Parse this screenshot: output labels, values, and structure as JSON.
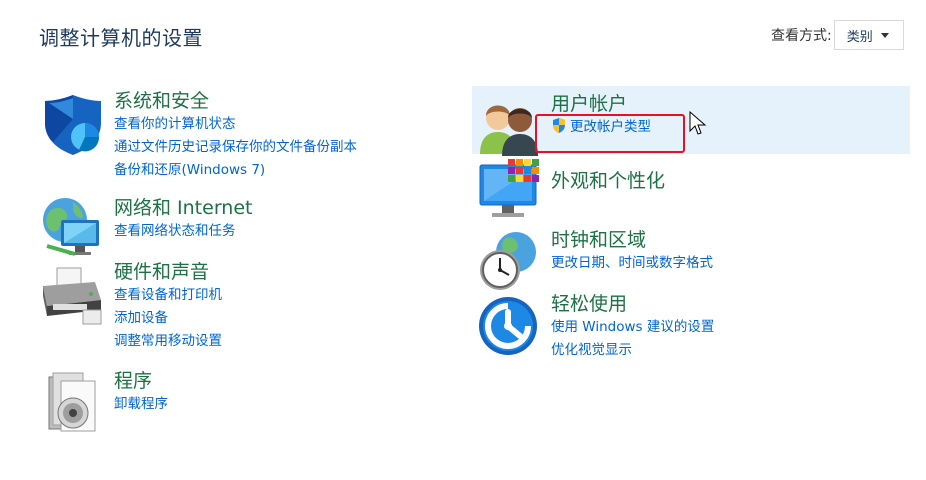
{
  "header": {
    "title": "调整计算机的设置",
    "view_by_label": "查看方式:",
    "view_by_value": "类别"
  },
  "categories_left": [
    {
      "id": "system-security",
      "icon": "shield-icon",
      "title": "系统和安全",
      "links": [
        "查看你的计算机状态",
        "通过文件历史记录保存你的文件备份副本",
        "备份和还原(Windows 7)"
      ]
    },
    {
      "id": "network-internet",
      "icon": "network-globe-icon",
      "title": "网络和 Internet",
      "links": [
        "查看网络状态和任务"
      ]
    },
    {
      "id": "hardware-sound",
      "icon": "printer-icon",
      "title": "硬件和声音",
      "links": [
        "查看设备和打印机",
        "添加设备",
        "调整常用移动设置"
      ]
    },
    {
      "id": "programs",
      "icon": "programs-disc-icon",
      "title": "程序",
      "links": [
        "卸载程序"
      ]
    }
  ],
  "categories_right": [
    {
      "id": "user-accounts",
      "icon": "users-icon",
      "title": "用户帐户",
      "links": [
        "更改帐户类型"
      ],
      "link_icon": "uac-shield-icon",
      "highlighted": true
    },
    {
      "id": "appearance",
      "icon": "monitor-tiles-icon",
      "title": "外观和个性化",
      "links": []
    },
    {
      "id": "clock-region",
      "icon": "clock-globe-icon",
      "title": "时钟和区域",
      "links": [
        "更改日期、时间或数字格式"
      ]
    },
    {
      "id": "ease-of-access",
      "icon": "accessibility-icon",
      "title": "轻松使用",
      "links": [
        "使用 Windows 建议的设置",
        "优化视觉显示"
      ]
    }
  ],
  "colors": {
    "title_text": "#1e395b",
    "category_title": "#1e7145",
    "link": "#0066cc",
    "highlight_bg": "#e5f1fb",
    "annotation_red": "#e81123"
  }
}
